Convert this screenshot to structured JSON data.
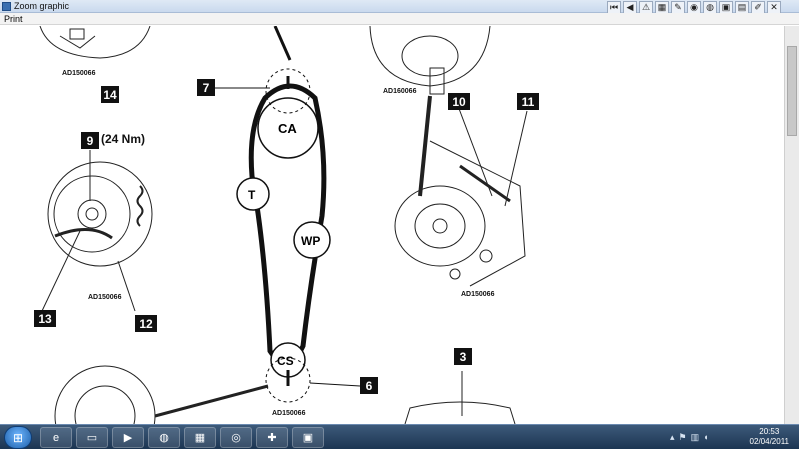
{
  "window": {
    "title": "Zoom graphic",
    "menu_print": "Print"
  },
  "diagram": {
    "labels": {
      "ca": "CA",
      "t": "T",
      "wp": "WP",
      "cs": "CS"
    },
    "callouts": {
      "c3": "3",
      "c6": "6",
      "c7": "7",
      "c9": "9",
      "c10": "10",
      "c11": "11",
      "c12": "12",
      "c13": "13",
      "c14": "14"
    },
    "torque": "(24 Nm)",
    "refs": {
      "r1": "AD150066",
      "r2": "AD160066",
      "r3": "AD150066",
      "r4": "AD150066",
      "r5": "AD150066"
    }
  },
  "taskbar": {
    "time": "20:53",
    "date": "02/04/2011"
  }
}
